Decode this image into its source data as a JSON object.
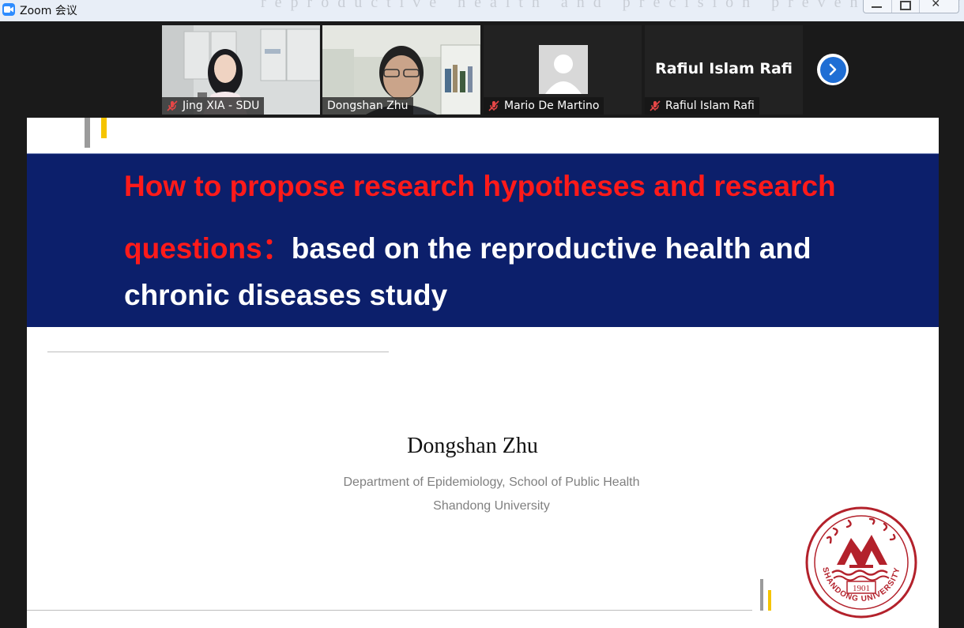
{
  "window": {
    "app_title": "Zoom 会议",
    "background_ghost_text": "reproductive health and precision prevention of chronic diseases,"
  },
  "participants": [
    {
      "name": "Jing XIA - SDU",
      "muted": true,
      "video": true
    },
    {
      "name": "Dongshan Zhu",
      "muted": false,
      "video": true,
      "active_speaker": true
    },
    {
      "name": "Mario De Martino",
      "muted": true,
      "video": false
    },
    {
      "name": "Rafiul Islam Rafi",
      "muted": true,
      "video": false,
      "display_name_large": "Rafiul Islam Rafi"
    }
  ],
  "slide": {
    "title_red_line1": "How to propose research hypotheses and research",
    "title_red_line2": "questions：",
    "title_white_line2": "based on the reproductive health and",
    "title_white_line3": "chronic diseases study",
    "author": "Dongshan Zhu",
    "affiliation_line1": "Department of Epidemiology, School of Public Health",
    "affiliation_line2": "Shandong University",
    "seal_text": "SHANDONG UNIVERSITY",
    "seal_year": "1901"
  },
  "colors": {
    "banner": "#0c1f6b",
    "title_red": "#ff1a1a",
    "accent_gray": "#9b9b9b",
    "accent_yellow": "#f5c400",
    "seal_red": "#b3212b",
    "active_speaker_border": "#8fd14f",
    "next_button": "#1f6ed4"
  },
  "icons": [
    "zoom-camera-icon",
    "minimize-icon",
    "maximize-icon",
    "close-icon",
    "mic-muted-icon",
    "chevron-right-icon",
    "avatar-placeholder-icon"
  ]
}
